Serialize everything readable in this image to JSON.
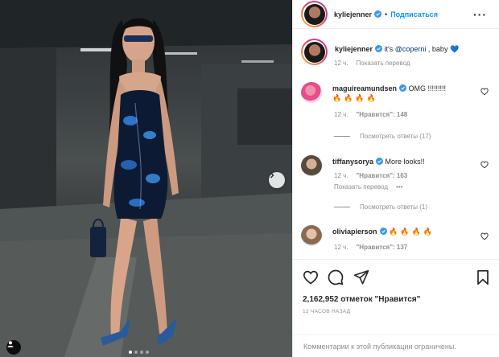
{
  "post": {
    "author": "kyliejenner",
    "follow_label": "Подписаться",
    "separator": "•",
    "caption_prefix": "it's ",
    "caption_mention": "@coperni",
    "caption_suffix": " , baby 💙",
    "caption_time": "12 ч.",
    "caption_translate": "Показать перевод",
    "carousel": {
      "slides": 4,
      "active": 1
    }
  },
  "comments": [
    {
      "user": "maguireamundsen",
      "text": "OMG !!!!!!!!!",
      "emoji": "🔥🔥🔥🔥",
      "time": "12 ч.",
      "likes": "\"Нравится\": 148",
      "replies": "Посмотреть ответы (17)"
    },
    {
      "user": "tiffanysorya",
      "text": "More looks!!",
      "time": "12 ч.",
      "likes": "\"Нравится\": 163",
      "translate": "Показать перевод",
      "options": "•••",
      "replies": "Посмотреть ответы (1)"
    },
    {
      "user": "oliviapierson",
      "emoji": "🔥🔥🔥🔥",
      "time": "12 ч.",
      "likes": "\"Нравится\": 137"
    }
  ],
  "stats": {
    "likes_text": "2,162,952 отметок \"Нравится\"",
    "time_ago": "12 ЧАСОВ НАЗАД"
  },
  "footer": {
    "comments_disabled": "Комментарии к этой публикации ограничены."
  },
  "icons": {
    "heart": "heart-icon",
    "comment": "comment-icon",
    "share": "paper-plane-icon",
    "save": "bookmark-icon",
    "verified": "verified-badge-icon",
    "next": "chevron-right-icon",
    "tag": "person-tag-icon",
    "more": "more-options-icon"
  },
  "colors": {
    "link_blue": "#0095f6",
    "verified_blue": "#3897f0",
    "muted": "#8e8e8e",
    "text": "#262626"
  }
}
